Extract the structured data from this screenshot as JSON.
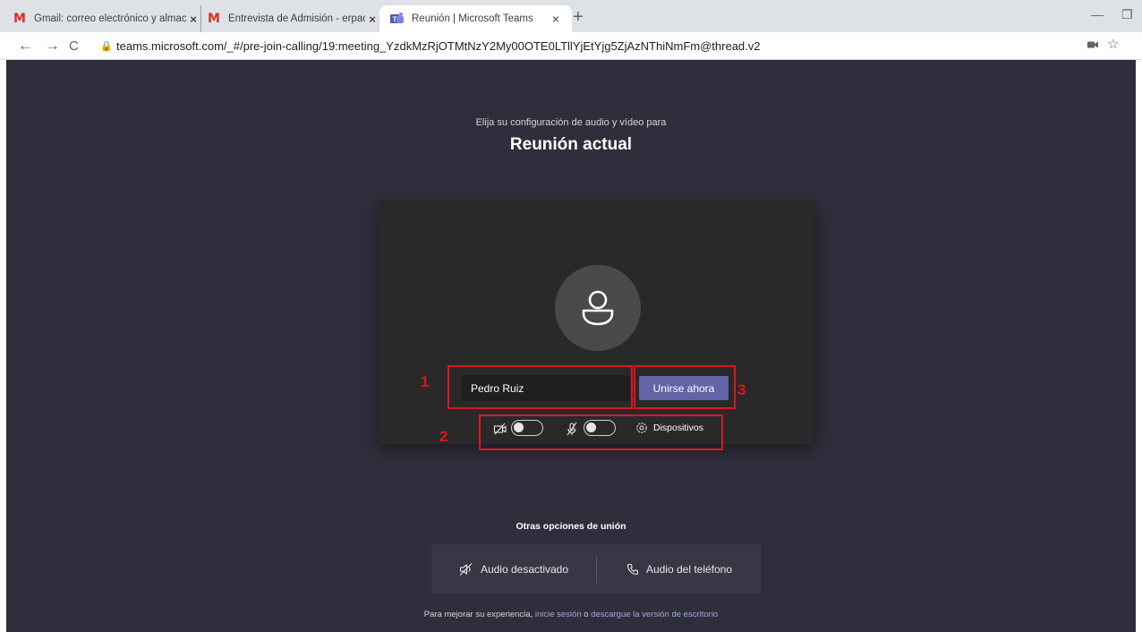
{
  "browser": {
    "tabs": [
      {
        "title": "Gmail: correo electrónico y almac",
        "icon": "gmail-icon",
        "close": "×"
      },
      {
        "title": "Entrevista de Admisión - erpacal",
        "icon": "gmail-icon",
        "close": "×"
      },
      {
        "title": "Reunión | Microsoft Teams",
        "icon": "teams-icon",
        "close": "×",
        "active": true
      }
    ],
    "new_tab": "+",
    "url": "teams.microsoft.com/_#/pre-join-calling/19:meeting_YzdkMzRjOTMtNzY2My00OTE0LTllYjEtYjg5ZjAzNThiNmFm@thread.v2"
  },
  "prejoin": {
    "subtitle": "Elija su configuración de audio y vídeo para",
    "title": "Reunión actual",
    "name_value": "Pedro Ruiz",
    "join_label": "Unirse ahora",
    "camera_toggle": "off",
    "mic_toggle": "off",
    "devices_label": "Dispositivos"
  },
  "annotations": [
    "1",
    "2",
    "3"
  ],
  "other_options": {
    "heading": "Otras opciones de unión",
    "audio_off_label": "Audio desactivado",
    "phone_audio_label": "Audio del teléfono"
  },
  "footer": {
    "text_before": "Para mejorar su experiencia, ",
    "link_signin": "inicie sesión",
    "text_middle": " o ",
    "link_download": "descargue la versión de escritorio"
  },
  "colors": {
    "background": "#2f2e3c",
    "card": "#292929",
    "accent": "#6264a7",
    "annotation": "#e0151d"
  }
}
